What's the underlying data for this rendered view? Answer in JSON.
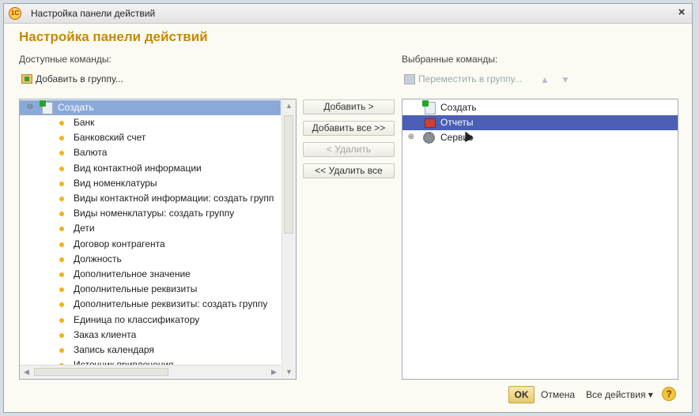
{
  "window": {
    "title": "Настройка панели действий",
    "close_label": "×"
  },
  "header": {
    "title": "Настройка панели действий"
  },
  "left": {
    "label": "Доступные команды:",
    "add_to_group": "Добавить в группу...",
    "group_name": "Создать",
    "items": [
      "Банк",
      "Банковский счет",
      "Валюта",
      "Вид контактной информации",
      "Вид номенклатуры",
      "Виды контактной информации: создать групп",
      "Виды номенклатуры: создать группу",
      "Дети",
      "Договор контрагента",
      "Должность",
      "Дополнительное значение",
      "Дополнительные реквизиты",
      "Дополнительные реквизиты: создать группу",
      "Единица по классификатору",
      "Заказ клиента",
      "Запись календаря",
      "Источник привлечения"
    ]
  },
  "middle": {
    "add": "Добавить >",
    "add_all": "Добавить все >>",
    "remove": "< Удалить",
    "remove_all": "<< Удалить все"
  },
  "right": {
    "label": "Выбранные команды:",
    "move_to_group": "Переместить в группу...",
    "items": [
      {
        "label": "Создать",
        "icon": "create-icon"
      },
      {
        "label": "Отчеты",
        "icon": "reports-icon"
      },
      {
        "label": "Сервис",
        "icon": "gear-icon"
      }
    ]
  },
  "footer": {
    "ok": "OK",
    "cancel": "Отмена",
    "all_actions": "Все действия ▾",
    "help": "?"
  }
}
